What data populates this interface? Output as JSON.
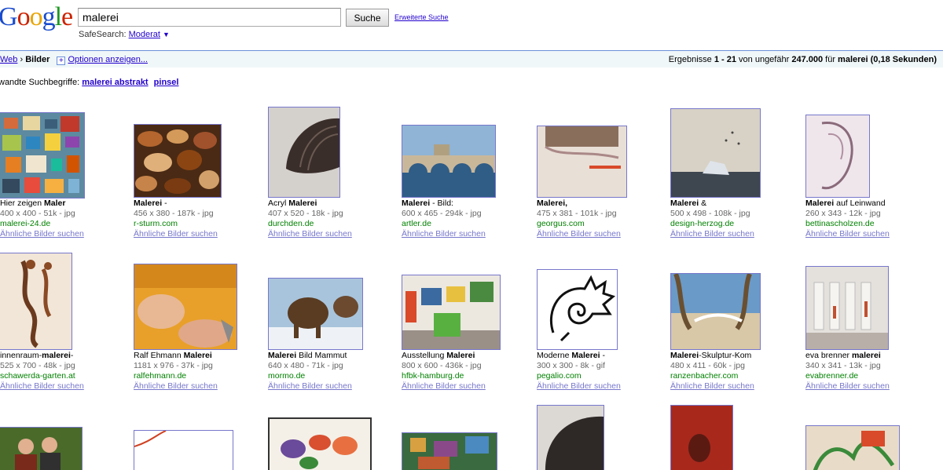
{
  "logo": {
    "letters": [
      "G",
      "o",
      "o",
      "g",
      "l",
      "e"
    ],
    "colors": [
      "#1a4ccc",
      "#cc2200",
      "#e8a400",
      "#1a4ccc",
      "#1a9922",
      "#cc2200"
    ]
  },
  "search": {
    "value": "malerei",
    "button": "Suche",
    "advanced": "Erweiterte Suche"
  },
  "safesearch": {
    "label": "SafeSearch:",
    "value": "Moderat",
    "arrow": "▼"
  },
  "bar": {
    "web": "Web",
    "sep": "›",
    "current": "Bilder",
    "plus": "+",
    "options": "Optionen anzeigen...",
    "stats_pre": "Ergebnisse ",
    "range": "1 - 21",
    "stats_mid": " von ungefähr ",
    "count": "247.000",
    "stats_for": " für ",
    "query": "malerei",
    "time": "(0,18 Sekunden)"
  },
  "related": {
    "label": "wandte Suchbegriffe:",
    "terms": [
      "malerei abstrakt",
      "pinsel"
    ]
  },
  "similar_label": "Ähnliche Bilder suchen",
  "row1": [
    {
      "pre": "Hier zeigen ",
      "bold": "Maler",
      "post": "",
      "meta": "400 x 400 - 51k - jpg",
      "domain": "malerei-24.de"
    },
    {
      "pre": "",
      "bold": "Malerei",
      "post": " -",
      "meta": "456 x 380 - 187k - jpg",
      "domain": "r-sturm.com"
    },
    {
      "pre": "Acryl ",
      "bold": "Malerei",
      "post": "",
      "meta": "407 x 520 - 18k - jpg",
      "domain": "durchden.de"
    },
    {
      "pre": "",
      "bold": "Malerei",
      "post": " - Bild:",
      "meta": "600 x 465 - 294k - jpg",
      "domain": "artler.de"
    },
    {
      "pre": "",
      "bold": "Malerei,",
      "post": "",
      "meta": "475 x 381 - 101k - jpg",
      "domain": "georgus.com"
    },
    {
      "pre": "",
      "bold": "Malerei",
      "post": " &",
      "meta": "500 x 498 - 108k - jpg",
      "domain": "design-herzog.de"
    },
    {
      "pre": "",
      "bold": "Malerei",
      "post": " auf Leinwand",
      "meta": "260 x 343 - 12k - jpg",
      "domain": "bettinascholzen.de"
    }
  ],
  "row2": [
    {
      "pre": "innenraum-",
      "bold": "malerei",
      "post": "-",
      "meta": "525 x 700 - 48k - jpg",
      "domain": "schawerda-garten.at"
    },
    {
      "pre": "Ralf Ehmann ",
      "bold": "Malerei",
      "post": "",
      "meta": "1181 x 976 - 37k - jpg",
      "domain": "ralfehmann.de"
    },
    {
      "pre": "",
      "bold": "Malerei",
      "post": " Bild Mammut",
      "meta": "640 x 480 - 71k - jpg",
      "domain": "mormo.de"
    },
    {
      "pre": "Ausstellung ",
      "bold": "Malerei",
      "post": "",
      "meta": "800 x 600 - 436k - jpg",
      "domain": "hfbk-hamburg.de"
    },
    {
      "pre": "Moderne ",
      "bold": "Malerei",
      "post": " -",
      "meta": "300 x 300 - 8k - gif",
      "domain": "pegalio.com"
    },
    {
      "pre": "",
      "bold": "Malerei",
      "post": "-Skulptur-Kom",
      "meta": "480 x 411 - 60k - jpg",
      "domain": "ranzenbacher.com"
    },
    {
      "pre": "eva brenner ",
      "bold": "malerei",
      "post": "",
      "meta": "340 x 341 - 13k - jpg",
      "domain": "evabrenner.de"
    }
  ]
}
